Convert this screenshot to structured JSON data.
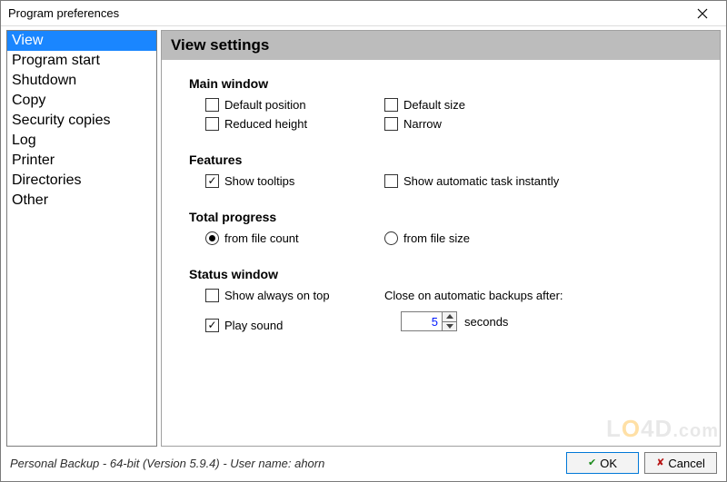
{
  "window": {
    "title": "Program preferences"
  },
  "sidebar": {
    "items": [
      {
        "label": "View",
        "selected": true
      },
      {
        "label": "Program start",
        "selected": false
      },
      {
        "label": "Shutdown",
        "selected": false
      },
      {
        "label": "Copy",
        "selected": false
      },
      {
        "label": "Security copies",
        "selected": false
      },
      {
        "label": "Log",
        "selected": false
      },
      {
        "label": "Printer",
        "selected": false
      },
      {
        "label": "Directories",
        "selected": false
      },
      {
        "label": "Other",
        "selected": false
      }
    ]
  },
  "content": {
    "heading": "View settings",
    "sections": {
      "main_window": {
        "title": "Main window",
        "default_position": {
          "label": "Default position",
          "checked": false
        },
        "default_size": {
          "label": "Default size",
          "checked": false
        },
        "reduced_height": {
          "label": "Reduced height",
          "checked": false
        },
        "narrow": {
          "label": "Narrow",
          "checked": false
        }
      },
      "features": {
        "title": "Features",
        "show_tooltips": {
          "label": "Show tooltips",
          "checked": true
        },
        "show_auto_task": {
          "label": "Show automatic task instantly",
          "checked": false
        }
      },
      "total_progress": {
        "title": "Total progress",
        "from_file_count": {
          "label": "from file count",
          "selected": true
        },
        "from_file_size": {
          "label": "from file size",
          "selected": false
        }
      },
      "status_window": {
        "title": "Status window",
        "always_on_top": {
          "label": "Show always on top",
          "checked": false
        },
        "play_sound": {
          "label": "Play sound",
          "checked": true
        },
        "close_label": "Close on automatic backups after:",
        "close_seconds": "5",
        "seconds_unit": "seconds"
      }
    }
  },
  "footer": {
    "status": "Personal Backup - 64-bit (Version 5.9.4) - User name: ahorn",
    "ok": "OK",
    "cancel": "Cancel"
  }
}
